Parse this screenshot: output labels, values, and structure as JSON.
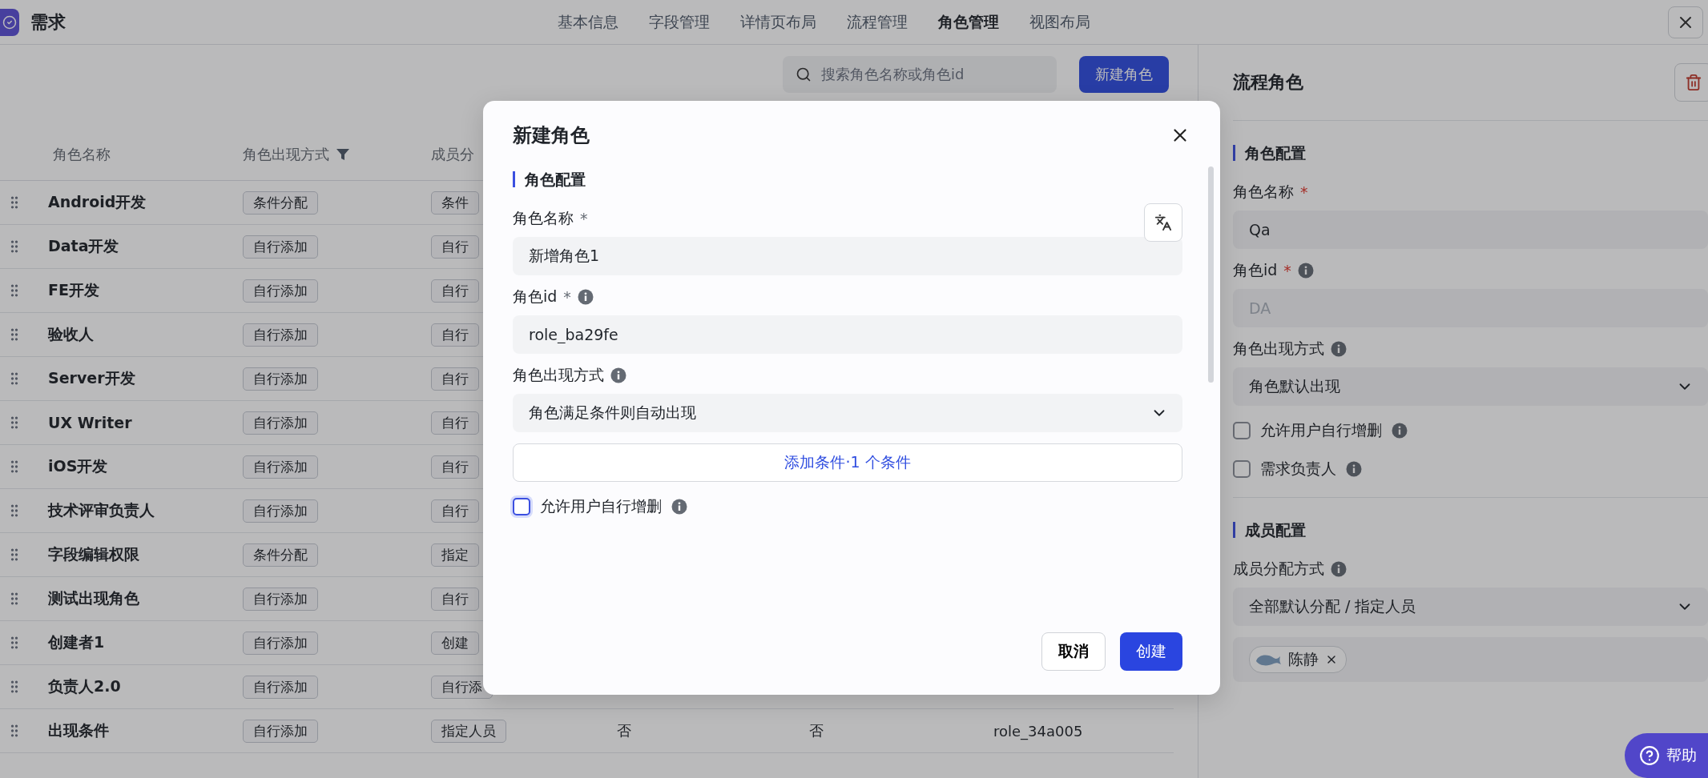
{
  "app": {
    "title": "需求"
  },
  "tabs": [
    {
      "label": "基本信息",
      "selected": false
    },
    {
      "label": "字段管理",
      "selected": false
    },
    {
      "label": "详情页布局",
      "selected": false
    },
    {
      "label": "流程管理",
      "selected": false
    },
    {
      "label": "角色管理",
      "selected": true
    },
    {
      "label": "视图布局",
      "selected": false
    }
  ],
  "toolbar": {
    "search": {
      "placeholder": "搜索角色名称或角色id"
    },
    "new_button": "新建角色"
  },
  "table": {
    "columns": [
      {
        "label": "角色名称"
      },
      {
        "label": "角色出现方式",
        "filter": true
      },
      {
        "label": "成员分"
      }
    ],
    "rows": [
      {
        "name": "Android开发",
        "appearance": "条件分配",
        "member": "条件"
      },
      {
        "name": "Data开发",
        "appearance": "自行添加",
        "member": "自行"
      },
      {
        "name": "FE开发",
        "appearance": "自行添加",
        "member": "自行"
      },
      {
        "name": "验收人",
        "appearance": "自行添加",
        "member": "自行"
      },
      {
        "name": "Server开发",
        "appearance": "自行添加",
        "member": "自行"
      },
      {
        "name": "UX Writer",
        "appearance": "自行添加",
        "member": "自行"
      },
      {
        "name": "iOS开发",
        "appearance": "自行添加",
        "member": "自行"
      },
      {
        "name": "技术评审负责人",
        "appearance": "自行添加",
        "member": "自行"
      },
      {
        "name": "字段编辑权限",
        "appearance": "条件分配",
        "member": "指定"
      },
      {
        "name": "测试出现角色",
        "appearance": "自行添加",
        "member": "自行"
      },
      {
        "name": "创建者1",
        "appearance": "自行添加",
        "member": "创建"
      },
      {
        "name": "负责人2.0",
        "appearance": "自行添加",
        "member": "自行添"
      },
      {
        "name": "出现条件",
        "appearance": "自行添加",
        "member": "指定人员",
        "cells": [
          "否",
          "否",
          "role_34a005"
        ]
      }
    ]
  },
  "modal": {
    "title": "新建角色",
    "section": "角色配置",
    "fields": [
      {
        "kind": "input",
        "label": "角色名称",
        "required": "*",
        "translate": true,
        "value": "新增角色1"
      },
      {
        "kind": "input",
        "label": "角色id",
        "required": "*",
        "info": true,
        "value": "role_ba29fe"
      },
      {
        "kind": "select",
        "label": "角色出现方式",
        "info": true,
        "value": "角色满足条件则自动出现"
      },
      {
        "kind": "action",
        "text": "添加条件·1 个条件"
      },
      {
        "kind": "checkbox",
        "label": "允许用户自行增删",
        "info": true,
        "checked": false
      }
    ],
    "cancel": "取消",
    "confirm": "创建"
  },
  "side_panel": {
    "title": "流程角色",
    "sections": [
      {
        "title": "角色配置",
        "fields": [
          {
            "kind": "input",
            "label": "角色名称",
            "required": "*",
            "value": "Qa"
          },
          {
            "kind": "input",
            "label": "角色id",
            "required": "*",
            "info": true,
            "disabled": true,
            "value": "DA"
          },
          {
            "kind": "select",
            "label": "角色出现方式",
            "info": true,
            "value": "角色默认出现"
          },
          {
            "kind": "checkbox",
            "label": "允许用户自行增删",
            "info": true,
            "checked": false
          },
          {
            "kind": "checkbox",
            "label": "需求负责人",
            "info": true,
            "checked": false
          }
        ]
      },
      {
        "title": "成员配置",
        "fields": [
          {
            "kind": "select",
            "label": "成员分配方式",
            "info": true,
            "value": "全部默认分配 / 指定人员"
          },
          {
            "kind": "members",
            "members": [
              "陈静"
            ]
          }
        ]
      }
    ]
  },
  "help_button": "帮助"
}
